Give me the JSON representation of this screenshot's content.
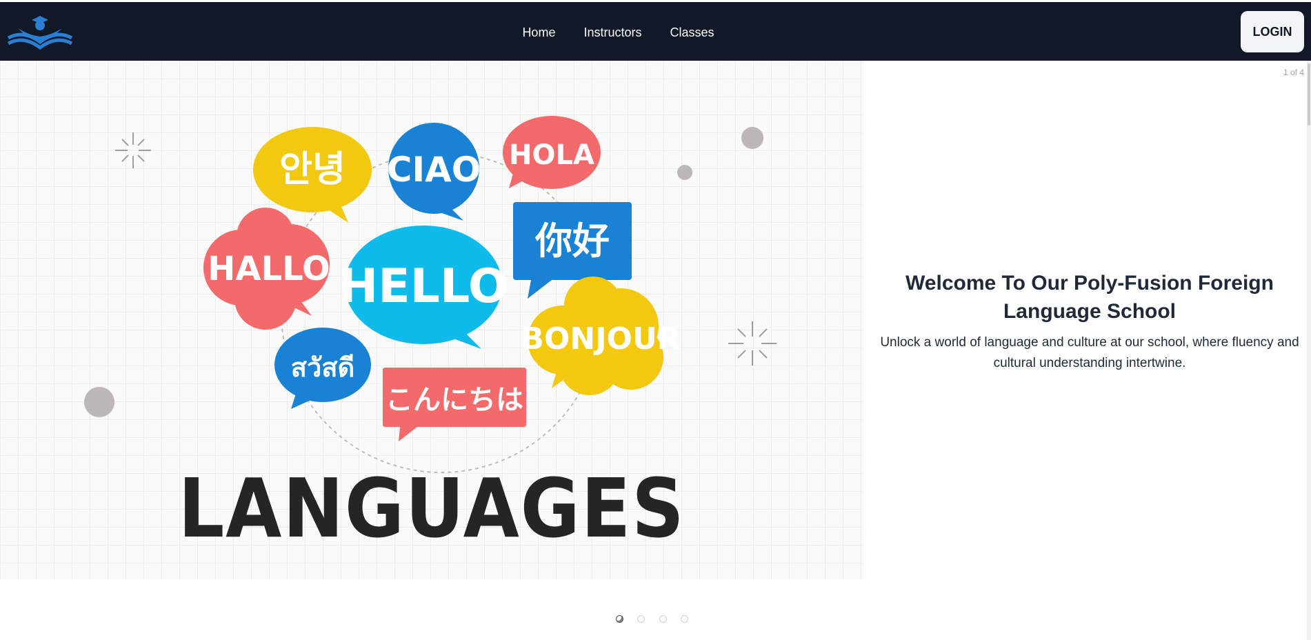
{
  "nav": {
    "links": [
      "Home",
      "Instructors",
      "Classes"
    ],
    "login_label": "LOGIN"
  },
  "carousel": {
    "counter": "1 of 4",
    "title": "Welcome To Our Poly-Fusion Foreign Language School",
    "subtitle": "Unlock a world of language and culture at our school, where fluency and cultural understanding intertwine.",
    "slide_count": 4,
    "active_slide": 1
  },
  "hero_image": {
    "bubbles": [
      "안녕",
      "CIAO",
      "HOLA",
      "你好",
      "HALLO",
      "HELLO",
      "BONJOUR",
      "สวัสดี",
      "こんにちは"
    ],
    "big_word": "LANGUAGES"
  },
  "colors": {
    "navbar": "#111827",
    "yellow": "#f2c811",
    "blue": "#1a82d4",
    "coral": "#f26a6a",
    "cyan": "#0fbbea"
  }
}
